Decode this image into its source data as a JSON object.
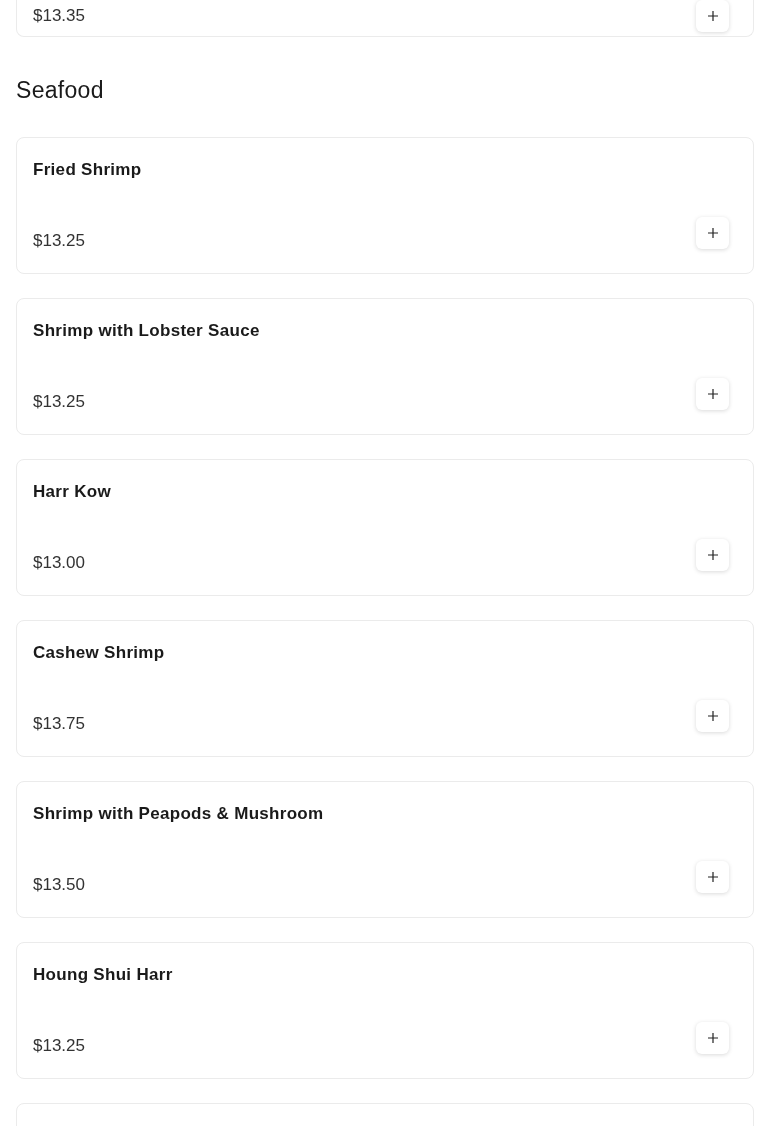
{
  "sections": [
    {
      "items": [
        {
          "price": "$13.35"
        }
      ]
    },
    {
      "title": "Seafood",
      "more_below": true,
      "items": [
        {
          "name": "Fried Shrimp",
          "price": "$13.25"
        },
        {
          "name": "Shrimp with Lobster Sauce",
          "price": "$13.25"
        },
        {
          "name": "Harr Kow",
          "price": "$13.00"
        },
        {
          "name": "Cashew Shrimp",
          "price": "$13.75"
        },
        {
          "name": "Shrimp with Peapods & Mushroom",
          "price": "$13.50"
        },
        {
          "name": "Houng Shui Harr",
          "price": "$13.25"
        }
      ]
    }
  ]
}
